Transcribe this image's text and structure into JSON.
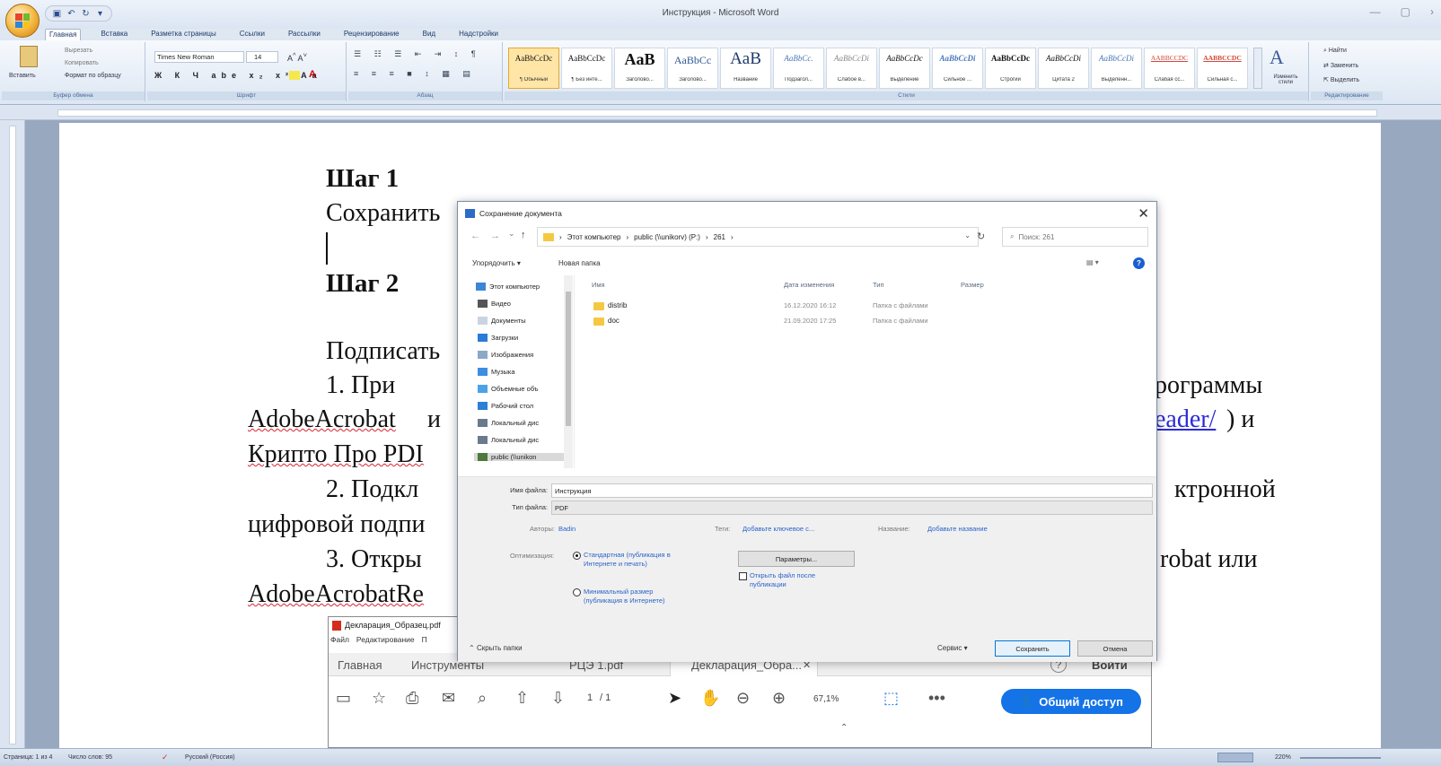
{
  "app": {
    "title": "Инструкция - Microsoft Word"
  },
  "quick_access": {
    "icons": [
      "save-icon",
      "undo-icon",
      "redo-icon",
      "customize-icon"
    ]
  },
  "tabs": [
    "Главная",
    "Вставка",
    "Разметка страницы",
    "Ссылки",
    "Рассылки",
    "Рецензирование",
    "Вид",
    "Надстройки"
  ],
  "ribbon": {
    "clipboard": {
      "paste": "Вставить",
      "cut": "Вырезать",
      "copy": "Копировать",
      "format_painter": "Формат по образцу",
      "label": "Буфер обмена"
    },
    "font": {
      "name": "Times New Roman",
      "size": "14",
      "label": "Шрифт"
    },
    "paragraph": {
      "label": "Абзац"
    },
    "styles": {
      "label": "Стили",
      "items": [
        {
          "sample": "AaBbCcDc",
          "name": "¶ Обычный"
        },
        {
          "sample": "AaBbCcDc",
          "name": "¶ Без инте..."
        },
        {
          "sample": "AaB",
          "name": "Заголово..."
        },
        {
          "sample": "AaBbCc",
          "name": "Заголово..."
        },
        {
          "sample": "AaB",
          "name": "Название"
        },
        {
          "sample": "AaBbCc.",
          "name": "Подзагол..."
        },
        {
          "sample": "AaBbCcDi",
          "name": "Слабое в..."
        },
        {
          "sample": "AaBbCcDc",
          "name": "Выделение"
        },
        {
          "sample": "AaBbCcDi",
          "name": "Сильное ..."
        },
        {
          "sample": "AaBbCcDc",
          "name": "Строгий"
        },
        {
          "sample": "AaBbCcDi",
          "name": "Цитата 2"
        },
        {
          "sample": "AaBbCcDi",
          "name": "Выделенн..."
        },
        {
          "sample": "AABBCCDC",
          "name": "Слабая сс..."
        },
        {
          "sample": "AABBCCDC",
          "name": "Сильная с..."
        }
      ],
      "change_styles": "Изменить стили"
    },
    "editing": {
      "find": "Найти",
      "replace": "Заменить",
      "select": "Выделить",
      "label": "Редактирование"
    }
  },
  "document": {
    "step1": "Шаг 1",
    "save_text": "Сохранить",
    "step2": "Шаг 2",
    "sign_text": "Подписать",
    "item1_start": "1.  При",
    "item1_end": "рограммы",
    "adobe": "AdobeAcrobat",
    "adobe_mid": "и",
    "reader_link": "eader/",
    "paren_and": ")  и",
    "crypto": "Крипто Про PDI",
    "item2_start": "2.  Подкл",
    "item2_end": "ктронной",
    "digital": "цифровой подпи",
    "item3_start": "3.  Откры",
    "item3_end": "robat  или",
    "adobe_reader": "AdobeAcrobatRe"
  },
  "save_dialog": {
    "title": "Сохранение документа",
    "path": [
      "Этот компьютер",
      "public (\\\\unikorv) (P:)",
      "261"
    ],
    "search_placeholder": "Поиск: 261",
    "organize": "Упорядочить ▾",
    "new_folder": "Новая папка",
    "nav_items": [
      {
        "label": "Этот компьютер",
        "icon": "computer-icon"
      },
      {
        "label": "Видео",
        "icon": "video-icon"
      },
      {
        "label": "Документы",
        "icon": "documents-icon"
      },
      {
        "label": "Загрузки",
        "icon": "downloads-icon"
      },
      {
        "label": "Изображения",
        "icon": "pictures-icon"
      },
      {
        "label": "Музыка",
        "icon": "music-icon"
      },
      {
        "label": "Объемные объ",
        "icon": "3d-objects-icon"
      },
      {
        "label": "Рабочий стол",
        "icon": "desktop-icon"
      },
      {
        "label": "Локальный дис",
        "icon": "drive-icon"
      },
      {
        "label": "Локальный дис",
        "icon": "drive-icon"
      },
      {
        "label": "public (\\\\unikon",
        "icon": "network-drive-icon"
      }
    ],
    "columns": [
      "Имя",
      "Дата изменения",
      "Тип",
      "Размер"
    ],
    "files": [
      {
        "name": "distrib",
        "date": "16.12.2020 16:12",
        "type": "Папка с файлами"
      },
      {
        "name": "doc",
        "date": "21.09.2020 17:25",
        "type": "Папка с файлами"
      }
    ],
    "filename_label": "Имя файла:",
    "filename": "Инструкция",
    "filetype_label": "Тип файла:",
    "filetype": "PDF",
    "authors_label": "Авторы:",
    "authors": "Badin",
    "tags_label": "Теги:",
    "tags": "Добавьте ключевое с...",
    "name_label": "Название:",
    "name_value": "Добавьте название",
    "optimize_label": "Оптимизация:",
    "opt_standard": "Стандартная (публикация в Интернете и печать)",
    "opt_min": "Минимальный размер (публикация в Интернете)",
    "params_btn": "Параметры...",
    "open_after": "Открыть файл после публикации",
    "hide_folders": "Скрыть папки",
    "service": "Сервис",
    "save_btn": "Сохранить",
    "cancel_btn": "Отмена"
  },
  "acrobat": {
    "title": "Декларация_Образец.pdf",
    "menu": [
      "Файл",
      "Редактирование",
      "П"
    ],
    "tabs": [
      "Главная",
      "Инструменты",
      "РЦЭ 1.pdf",
      "Декларация_Обра..."
    ],
    "page": "1",
    "page_total": "/ 1",
    "zoom": "67,1%",
    "help": "?",
    "login": "Войти",
    "share": "Общий доступ"
  },
  "statusbar": {
    "page": "Страница: 1 из 4",
    "words": "Число слов: 95",
    "language": "Русский (Россия)",
    "zoom": "220%"
  }
}
